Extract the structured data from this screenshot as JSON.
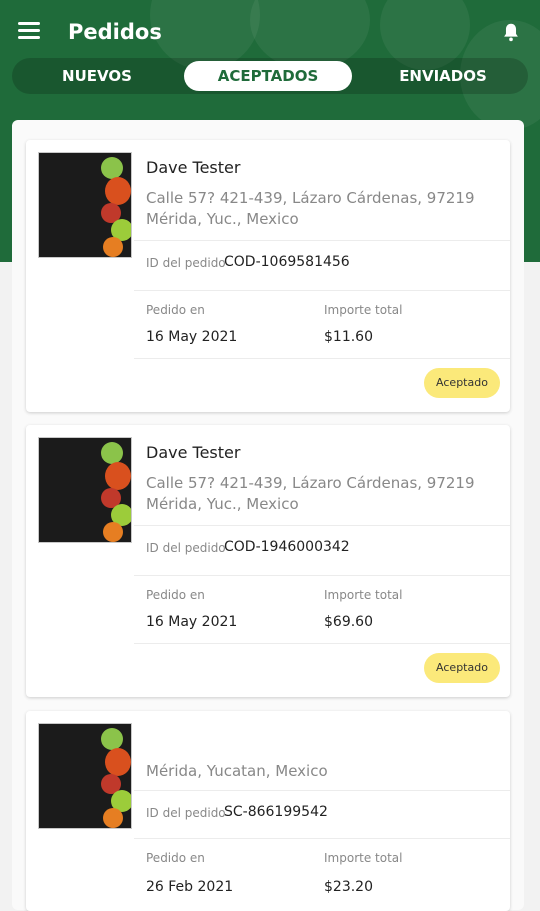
{
  "header": {
    "title": "Pedidos"
  },
  "tabs": [
    {
      "label": "NUEVOS"
    },
    {
      "label": "ACEPTADOS"
    },
    {
      "label": "ENVIADOS"
    }
  ],
  "orders": [
    {
      "name": "Dave Tester",
      "address": "Calle 57? 421-439, Lázaro Cárdenas, 97219 Mérida, Yuc., Mexico",
      "id_label": "ID del pedido",
      "id": "COD-1069581456",
      "date_label": "Pedido en",
      "date": "16 May 2021",
      "total_label": "Importe total",
      "total": "$11.60",
      "status": "Aceptado"
    },
    {
      "name": "Dave Tester",
      "address": "Calle 57? 421-439, Lázaro Cárdenas, 97219 Mérida, Yuc., Mexico",
      "id_label": "ID del pedido",
      "id": "COD-1946000342",
      "date_label": "Pedido en",
      "date": "16 May 2021",
      "total_label": "Importe total",
      "total": "$69.60",
      "status": "Aceptado"
    },
    {
      "name": "",
      "address": "Mérida, Yucatan, Mexico",
      "id_label": "ID del pedido",
      "id": "SC-866199542",
      "date_label": "Pedido en",
      "date": "26 Feb 2021",
      "total_label": "Importe total",
      "total": "$23.20",
      "status": ""
    }
  ],
  "colors": {
    "brand_green": "#1f6b3a",
    "badge_yellow": "#fbe97a"
  },
  "icons": {
    "menu": "hamburger-menu-icon",
    "notifications": "bell-icon"
  }
}
